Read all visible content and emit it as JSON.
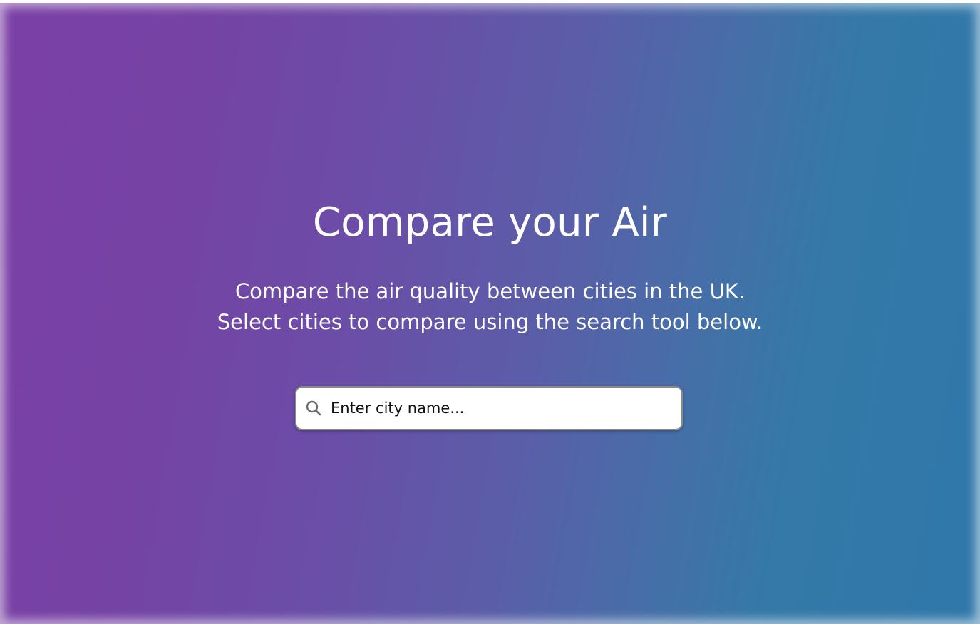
{
  "hero": {
    "title": "Compare your Air",
    "subtitle_lines": [
      "Compare the air quality between cities in the UK.",
      "Select cities to compare using the search tool below."
    ],
    "gradient_colors": [
      "#7b3fa6",
      "#3078aa"
    ]
  },
  "search": {
    "icon": "search-icon",
    "placeholder": "Enter city name...",
    "value": ""
  }
}
